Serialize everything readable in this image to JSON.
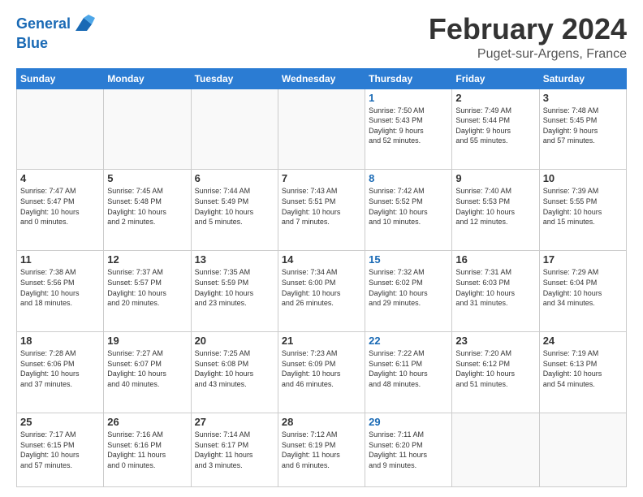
{
  "logo": {
    "line1": "General",
    "line2": "Blue"
  },
  "header": {
    "title": "February 2024",
    "subtitle": "Puget-sur-Argens, France"
  },
  "weekdays": [
    "Sunday",
    "Monday",
    "Tuesday",
    "Wednesday",
    "Thursday",
    "Friday",
    "Saturday"
  ],
  "weeks": [
    [
      {
        "day": "",
        "lines": []
      },
      {
        "day": "",
        "lines": []
      },
      {
        "day": "",
        "lines": []
      },
      {
        "day": "",
        "lines": []
      },
      {
        "day": "1",
        "lines": [
          "Sunrise: 7:50 AM",
          "Sunset: 5:43 PM",
          "Daylight: 9 hours",
          "and 52 minutes."
        ],
        "thursday": true
      },
      {
        "day": "2",
        "lines": [
          "Sunrise: 7:49 AM",
          "Sunset: 5:44 PM",
          "Daylight: 9 hours",
          "and 55 minutes."
        ]
      },
      {
        "day": "3",
        "lines": [
          "Sunrise: 7:48 AM",
          "Sunset: 5:45 PM",
          "Daylight: 9 hours",
          "and 57 minutes."
        ]
      }
    ],
    [
      {
        "day": "4",
        "lines": [
          "Sunrise: 7:47 AM",
          "Sunset: 5:47 PM",
          "Daylight: 10 hours",
          "and 0 minutes."
        ]
      },
      {
        "day": "5",
        "lines": [
          "Sunrise: 7:45 AM",
          "Sunset: 5:48 PM",
          "Daylight: 10 hours",
          "and 2 minutes."
        ]
      },
      {
        "day": "6",
        "lines": [
          "Sunrise: 7:44 AM",
          "Sunset: 5:49 PM",
          "Daylight: 10 hours",
          "and 5 minutes."
        ]
      },
      {
        "day": "7",
        "lines": [
          "Sunrise: 7:43 AM",
          "Sunset: 5:51 PM",
          "Daylight: 10 hours",
          "and 7 minutes."
        ]
      },
      {
        "day": "8",
        "lines": [
          "Sunrise: 7:42 AM",
          "Sunset: 5:52 PM",
          "Daylight: 10 hours",
          "and 10 minutes."
        ],
        "thursday": true
      },
      {
        "day": "9",
        "lines": [
          "Sunrise: 7:40 AM",
          "Sunset: 5:53 PM",
          "Daylight: 10 hours",
          "and 12 minutes."
        ]
      },
      {
        "day": "10",
        "lines": [
          "Sunrise: 7:39 AM",
          "Sunset: 5:55 PM",
          "Daylight: 10 hours",
          "and 15 minutes."
        ]
      }
    ],
    [
      {
        "day": "11",
        "lines": [
          "Sunrise: 7:38 AM",
          "Sunset: 5:56 PM",
          "Daylight: 10 hours",
          "and 18 minutes."
        ]
      },
      {
        "day": "12",
        "lines": [
          "Sunrise: 7:37 AM",
          "Sunset: 5:57 PM",
          "Daylight: 10 hours",
          "and 20 minutes."
        ]
      },
      {
        "day": "13",
        "lines": [
          "Sunrise: 7:35 AM",
          "Sunset: 5:59 PM",
          "Daylight: 10 hours",
          "and 23 minutes."
        ]
      },
      {
        "day": "14",
        "lines": [
          "Sunrise: 7:34 AM",
          "Sunset: 6:00 PM",
          "Daylight: 10 hours",
          "and 26 minutes."
        ]
      },
      {
        "day": "15",
        "lines": [
          "Sunrise: 7:32 AM",
          "Sunset: 6:02 PM",
          "Daylight: 10 hours",
          "and 29 minutes."
        ],
        "thursday": true
      },
      {
        "day": "16",
        "lines": [
          "Sunrise: 7:31 AM",
          "Sunset: 6:03 PM",
          "Daylight: 10 hours",
          "and 31 minutes."
        ]
      },
      {
        "day": "17",
        "lines": [
          "Sunrise: 7:29 AM",
          "Sunset: 6:04 PM",
          "Daylight: 10 hours",
          "and 34 minutes."
        ]
      }
    ],
    [
      {
        "day": "18",
        "lines": [
          "Sunrise: 7:28 AM",
          "Sunset: 6:06 PM",
          "Daylight: 10 hours",
          "and 37 minutes."
        ]
      },
      {
        "day": "19",
        "lines": [
          "Sunrise: 7:27 AM",
          "Sunset: 6:07 PM",
          "Daylight: 10 hours",
          "and 40 minutes."
        ]
      },
      {
        "day": "20",
        "lines": [
          "Sunrise: 7:25 AM",
          "Sunset: 6:08 PM",
          "Daylight: 10 hours",
          "and 43 minutes."
        ]
      },
      {
        "day": "21",
        "lines": [
          "Sunrise: 7:23 AM",
          "Sunset: 6:09 PM",
          "Daylight: 10 hours",
          "and 46 minutes."
        ]
      },
      {
        "day": "22",
        "lines": [
          "Sunrise: 7:22 AM",
          "Sunset: 6:11 PM",
          "Daylight: 10 hours",
          "and 48 minutes."
        ],
        "thursday": true
      },
      {
        "day": "23",
        "lines": [
          "Sunrise: 7:20 AM",
          "Sunset: 6:12 PM",
          "Daylight: 10 hours",
          "and 51 minutes."
        ]
      },
      {
        "day": "24",
        "lines": [
          "Sunrise: 7:19 AM",
          "Sunset: 6:13 PM",
          "Daylight: 10 hours",
          "and 54 minutes."
        ]
      }
    ],
    [
      {
        "day": "25",
        "lines": [
          "Sunrise: 7:17 AM",
          "Sunset: 6:15 PM",
          "Daylight: 10 hours",
          "and 57 minutes."
        ]
      },
      {
        "day": "26",
        "lines": [
          "Sunrise: 7:16 AM",
          "Sunset: 6:16 PM",
          "Daylight: 11 hours",
          "and 0 minutes."
        ]
      },
      {
        "day": "27",
        "lines": [
          "Sunrise: 7:14 AM",
          "Sunset: 6:17 PM",
          "Daylight: 11 hours",
          "and 3 minutes."
        ]
      },
      {
        "day": "28",
        "lines": [
          "Sunrise: 7:12 AM",
          "Sunset: 6:19 PM",
          "Daylight: 11 hours",
          "and 6 minutes."
        ]
      },
      {
        "day": "29",
        "lines": [
          "Sunrise: 7:11 AM",
          "Sunset: 6:20 PM",
          "Daylight: 11 hours",
          "and 9 minutes."
        ],
        "thursday": true
      },
      {
        "day": "",
        "lines": []
      },
      {
        "day": "",
        "lines": []
      }
    ]
  ]
}
